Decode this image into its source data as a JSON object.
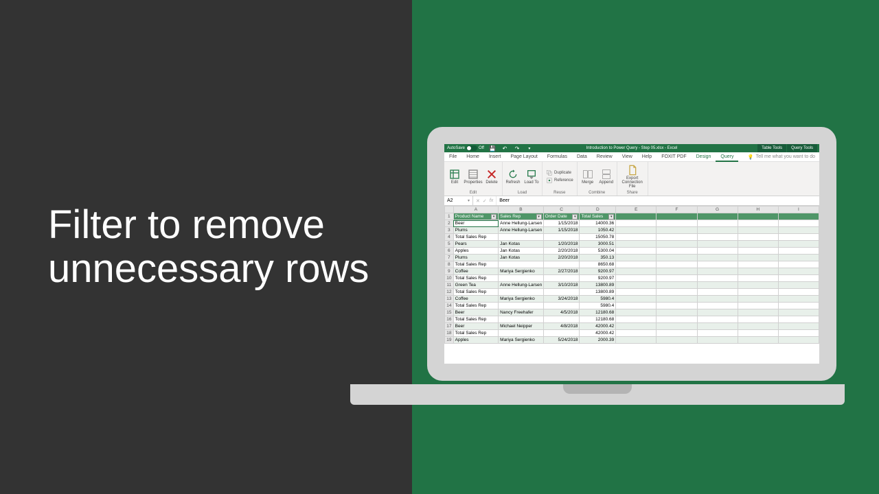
{
  "slide_title": "Filter to remove unnecessary rows",
  "titlebar": {
    "autosave_label": "AutoSave",
    "autosave_state": "Off",
    "doc_title": "Introduction to Power Query - Step 05.xlsx - Excel",
    "context_tab_1": "Table Tools",
    "context_tab_2": "Query Tools"
  },
  "tabs": {
    "file": "File",
    "home": "Home",
    "insert": "Insert",
    "page_layout": "Page Layout",
    "formulas": "Formulas",
    "data": "Data",
    "review": "Review",
    "view": "View",
    "help": "Help",
    "foxit": "FOXIT PDF",
    "design": "Design",
    "query": "Query",
    "tellme": "Tell me what you want to do"
  },
  "ribbon": {
    "edit_group": "Edit",
    "edit": "Edit",
    "properties": "Properties",
    "delete": "Delete",
    "load_group": "Load",
    "refresh": "Refresh",
    "load_to": "Load To",
    "reuse_group": "Reuse",
    "duplicate": "Duplicate",
    "reference": "Reference",
    "combine_group": "Combine",
    "merge": "Merge",
    "append": "Append",
    "share_group": "Share",
    "export": "Export Connection File"
  },
  "formula_bar": {
    "cell_ref": "A2",
    "fx": "fx",
    "value": "Beer"
  },
  "columns": [
    "A",
    "B",
    "C",
    "D",
    "E",
    "F",
    "G",
    "H",
    "I"
  ],
  "headers": {
    "product": "Product Name",
    "rep": "Sales Rep",
    "date": "Order Date",
    "total": "Total Sales"
  },
  "rows": [
    {
      "n": 2,
      "a": "Beer",
      "b": "Anne Hellung-Larsen",
      "c": "1/15/2018",
      "d": "14000.36",
      "stripe": false,
      "sel": true
    },
    {
      "n": 3,
      "a": "Plums",
      "b": "Anne Hellung-Larsen",
      "c": "1/15/2018",
      "d": "1050.42",
      "stripe": true
    },
    {
      "n": 4,
      "a": "Total Sales Rep",
      "b": "",
      "c": "",
      "d": "15050.78",
      "stripe": false
    },
    {
      "n": 5,
      "a": "Pears",
      "b": "Jan Kotas",
      "c": "1/20/2018",
      "d": "3000.51",
      "stripe": true
    },
    {
      "n": 6,
      "a": "Apples",
      "b": "Jan Kotas",
      "c": "2/20/2018",
      "d": "5300.04",
      "stripe": false
    },
    {
      "n": 7,
      "a": "Plums",
      "b": "Jan Kotas",
      "c": "2/20/2018",
      "d": "350.13",
      "stripe": true
    },
    {
      "n": 8,
      "a": "Total Sales Rep",
      "b": "",
      "c": "",
      "d": "8650.68",
      "stripe": false
    },
    {
      "n": 9,
      "a": "Coffee",
      "b": "Mariya Sergienko",
      "c": "2/27/2018",
      "d": "9200.97",
      "stripe": true
    },
    {
      "n": 10,
      "a": "Total Sales Rep",
      "b": "",
      "c": "",
      "d": "9200.97",
      "stripe": false
    },
    {
      "n": 11,
      "a": "Green Tea",
      "b": "Anne Hellung-Larsen",
      "c": "3/10/2018",
      "d": "13800.89",
      "stripe": true
    },
    {
      "n": 12,
      "a": "Total Sales Rep",
      "b": "",
      "c": "",
      "d": "13800.89",
      "stripe": false
    },
    {
      "n": 13,
      "a": "Coffee",
      "b": "Mariya Sergienko",
      "c": "3/24/2018",
      "d": "5980.4",
      "stripe": true
    },
    {
      "n": 14,
      "a": "Total Sales Rep",
      "b": "",
      "c": "",
      "d": "5980.4",
      "stripe": false
    },
    {
      "n": 15,
      "a": "Beer",
      "b": "Nancy Freehafer",
      "c": "4/5/2018",
      "d": "12180.68",
      "stripe": true
    },
    {
      "n": 16,
      "a": "Total Sales Rep",
      "b": "",
      "c": "",
      "d": "12180.68",
      "stripe": false
    },
    {
      "n": 17,
      "a": "Beer",
      "b": "Michael Neipper",
      "c": "4/8/2018",
      "d": "42000.42",
      "stripe": true
    },
    {
      "n": 18,
      "a": "Total Sales Rep",
      "b": "",
      "c": "",
      "d": "42000.42",
      "stripe": false
    },
    {
      "n": 19,
      "a": "Apples",
      "b": "Mariya Sergienko",
      "c": "5/24/2018",
      "d": "2000.39",
      "stripe": true
    }
  ]
}
